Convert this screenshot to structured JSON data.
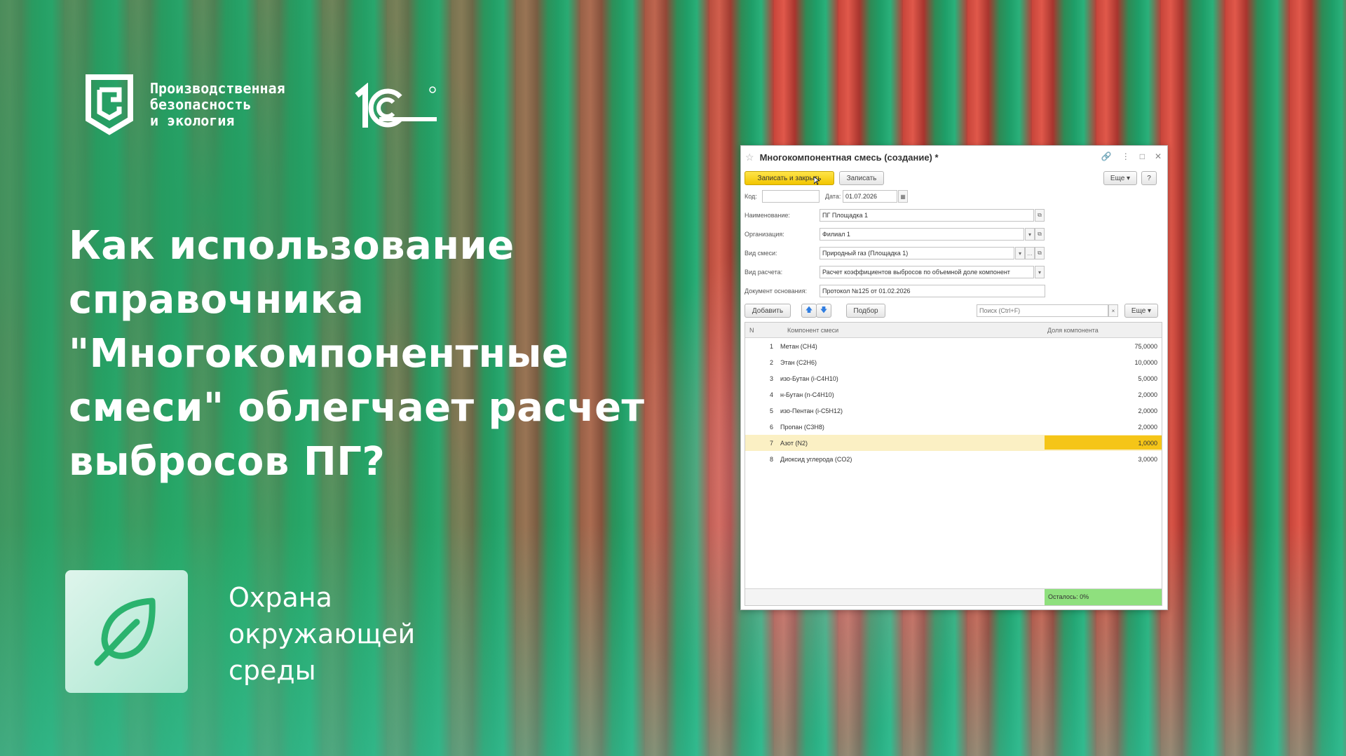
{
  "branding": {
    "pbe_line1": "Производственная",
    "pbe_line2": "безопасность",
    "pbe_line3": "и экология",
    "vendor": "1С"
  },
  "headline": "Как использование справочника \"Многокомпонентные смеси\" облегчает расчет выбросов ПГ?",
  "category": {
    "line1": "Охрана",
    "line2": "окружающей",
    "line3": "среды",
    "icon": "leaf-icon"
  },
  "window": {
    "title": "Многокомпонентная смесь (создание) *",
    "save_close": "Записать и закрыть",
    "save": "Записать",
    "more": "Еще",
    "help": "?",
    "fields": {
      "code_label": "Код:",
      "code_value": "",
      "date_label": "Дата:",
      "date_value": "01.07.2026",
      "name_label": "Наименование:",
      "name_value": "ПГ Площадка 1",
      "org_label": "Организация:",
      "org_value": "Филиал 1",
      "mix_label": "Вид смеси:",
      "mix_value": "Природный газ (Площадка 1)",
      "calc_label": "Вид расчета:",
      "calc_value": "Расчет коэффициентов выбросов по объемной доле компонент",
      "doc_label": "Документ основания:",
      "doc_value": "Протокол №125 от 01.02.2026"
    },
    "table_toolbar": {
      "add": "Добавить",
      "pick": "Подбор",
      "search_placeholder": "Поиск (Ctrl+F)",
      "more": "Еще"
    },
    "table": {
      "headers": [
        "N",
        "Компонент смеси",
        "Доля компонента"
      ],
      "rows": [
        {
          "n": "1",
          "component": "Метан (CH4)",
          "share": "75,0000"
        },
        {
          "n": "2",
          "component": "Этан (C2H6)",
          "share": "10,0000"
        },
        {
          "n": "3",
          "component": "изо-Бутан (i-C4H10)",
          "share": "5,0000"
        },
        {
          "n": "4",
          "component": "н-Бутан (n-C4H10)",
          "share": "2,0000"
        },
        {
          "n": "5",
          "component": "изо-Пентан (i-C5H12)",
          "share": "2,0000"
        },
        {
          "n": "6",
          "component": "Пропан (C3H8)",
          "share": "2,0000"
        },
        {
          "n": "7",
          "component": "Азот (N2)",
          "share": "1,0000"
        },
        {
          "n": "8",
          "component": "Диоксид углерода (CO2)",
          "share": "3,0000"
        }
      ],
      "selected_row": 7,
      "footer_remaining": "Осталось: 0%"
    },
    "colors": {
      "primary_button": "#f2c500",
      "selected_row": "#fbf0c4",
      "remaining_ok": "#8fe07e"
    }
  }
}
